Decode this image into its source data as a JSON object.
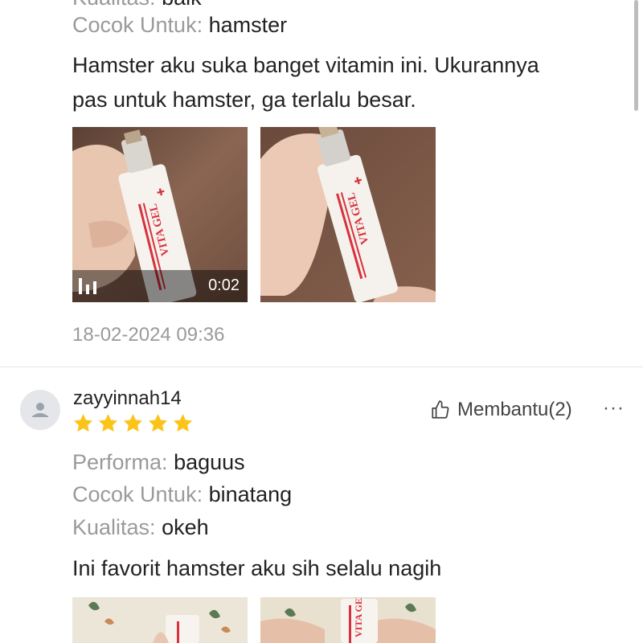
{
  "review1": {
    "partial_line": {
      "label": "Kualitas:",
      "value": "baik"
    },
    "attributes": [
      {
        "label": "Cocok Untuk:",
        "value": "hamster"
      }
    ],
    "text_line1": "Hamster aku suka banget vitamin ini. Ukurannya",
    "text_line2": "pas untuk hamster, ga terlalu besar.",
    "video_duration": "0:02",
    "product_label": "VITA GEL",
    "date": "18-02-2024 09:36"
  },
  "review2": {
    "username": "zayyinnah14",
    "rating": 5,
    "helpful_label": "Membantu(2)",
    "more_label": "···",
    "attributes": [
      {
        "label": "Performa:",
        "value": "baguus"
      },
      {
        "label": "Cocok Untuk:",
        "value": "binatang"
      },
      {
        "label": "Kualitas:",
        "value": "okeh"
      }
    ],
    "text": "Ini favorit hamster aku sih selalu nagih",
    "product_label": "VITA GEL"
  },
  "icons": {
    "avatar": "user-avatar-icon",
    "star": "star-icon",
    "helpful": "thumbs-up-icon",
    "video": "video-play-icon",
    "more": "more-options-icon"
  },
  "colors": {
    "star": "#fcc419",
    "muted_text": "#9a9a9a",
    "divider": "#e6e6e6",
    "brand_red": "#d9313b"
  }
}
